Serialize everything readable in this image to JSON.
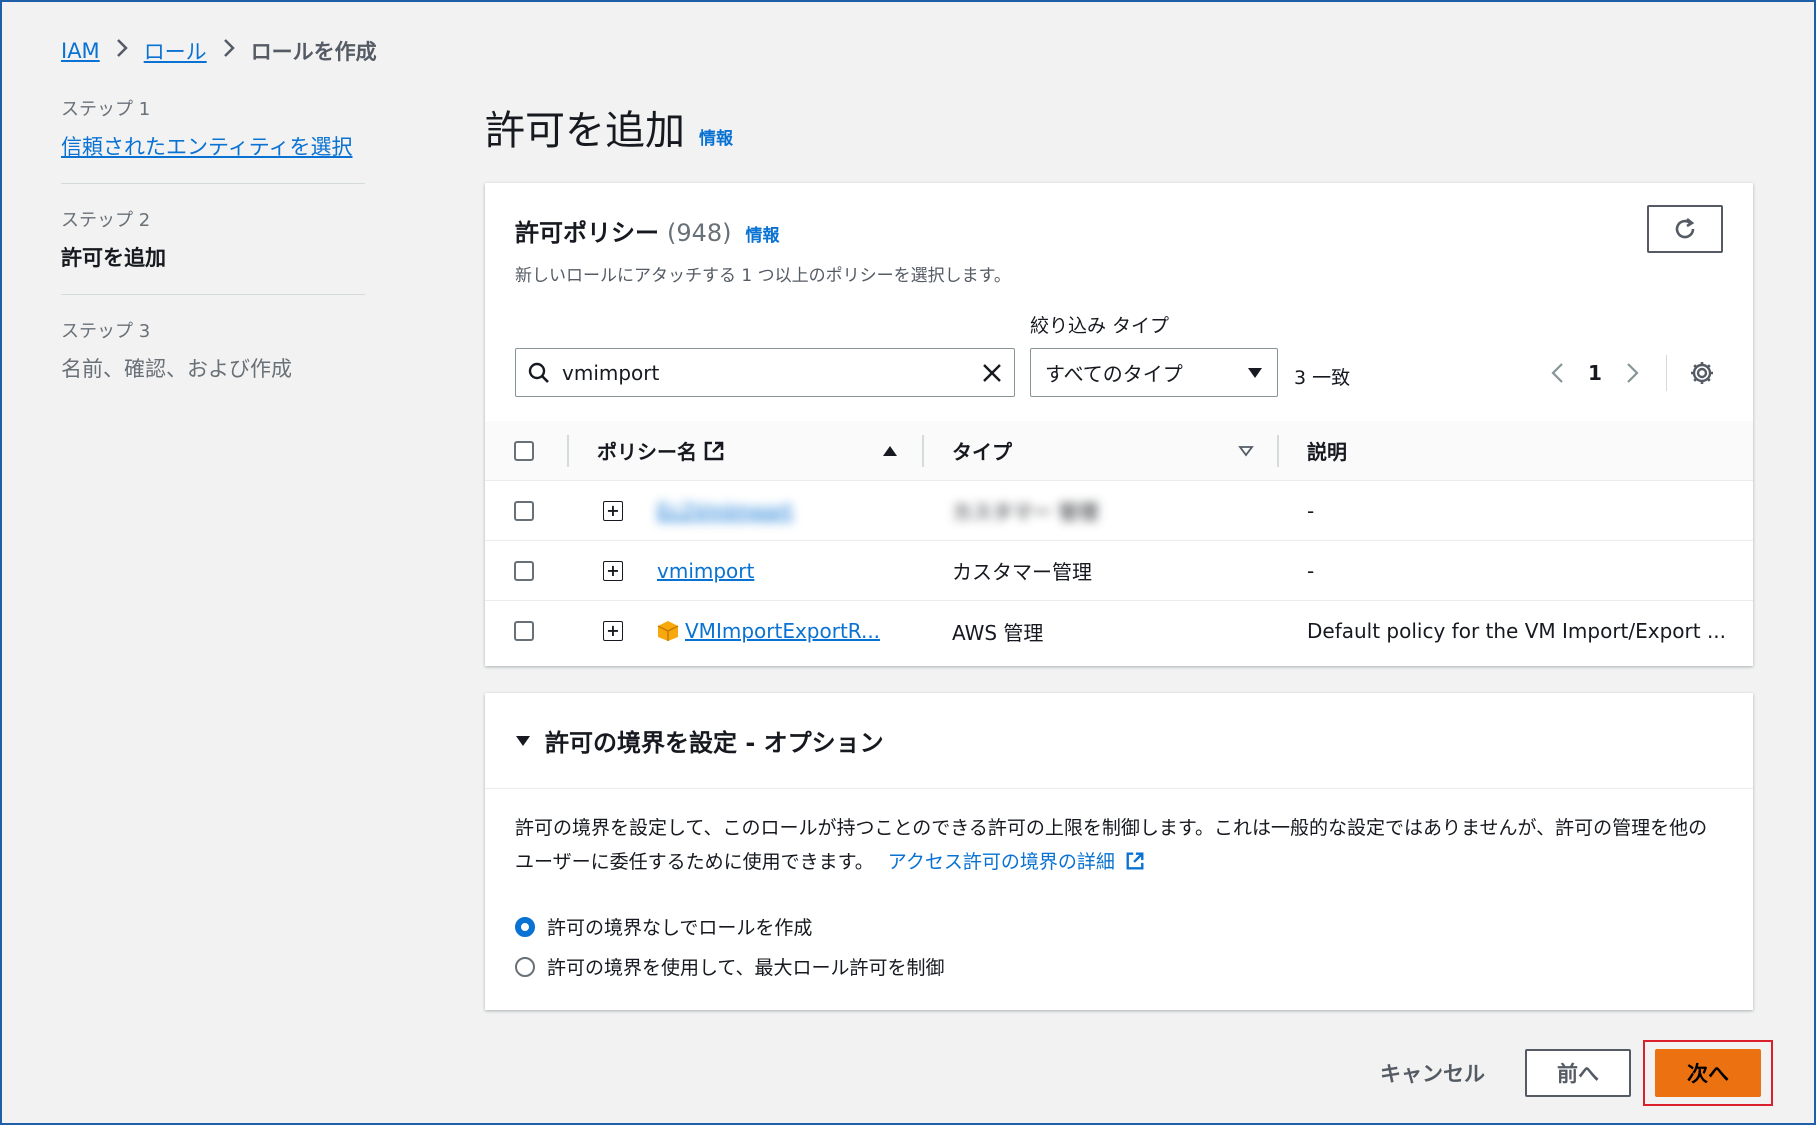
{
  "breadcrumb": {
    "items": [
      "IAM",
      "ロール"
    ],
    "current": "ロールを作成"
  },
  "steps": [
    {
      "num": "ステップ 1",
      "label": "信頼されたエンティティを選択"
    },
    {
      "num": "ステップ 2",
      "label": "許可を追加"
    },
    {
      "num": "ステップ 3",
      "label": "名前、確認、および作成"
    }
  ],
  "page": {
    "title": "許可を追加",
    "info": "情報"
  },
  "policies": {
    "title": "許可ポリシー",
    "count": "(948)",
    "info": "情報",
    "subtitle": "新しいロールにアタッチする 1 つ以上のポリシーを選択します。",
    "filter_label": "絞り込み タイプ",
    "search_value": "vmimport",
    "type_select": "すべてのタイプ",
    "match": "3 一致",
    "page": "1",
    "columns": {
      "name": "ポリシー名",
      "type": "タイプ",
      "desc": "説明"
    },
    "rows": [
      {
        "name": "Ec2VmImport",
        "type": "カスタマー 管理",
        "desc": "-"
      },
      {
        "name": "vmimport",
        "type": "カスタマー管理",
        "desc": "-"
      },
      {
        "name": "VMImportExportR...",
        "type": "AWS 管理",
        "desc": "Default policy for the VM Import/Export ..."
      }
    ]
  },
  "boundary": {
    "title": "許可の境界を設定 - オプション",
    "description": "許可の境界を設定して、このロールが持つことのできる許可の上限を制御します。これは一般的な設定ではありませんが、許可の管理を他のユーザーに委任するために使用できます。",
    "learn_more": "アクセス許可の境界の詳細",
    "options": [
      "許可の境界なしでロールを作成",
      "許可の境界を使用して、最大ロール許可を制御"
    ]
  },
  "actions": {
    "cancel": "キャンセル",
    "prev": "前へ",
    "next": "次へ"
  },
  "colors": {
    "link": "#0972d3",
    "primary_button": "#ec7211",
    "highlight_box": "#d9202c"
  }
}
